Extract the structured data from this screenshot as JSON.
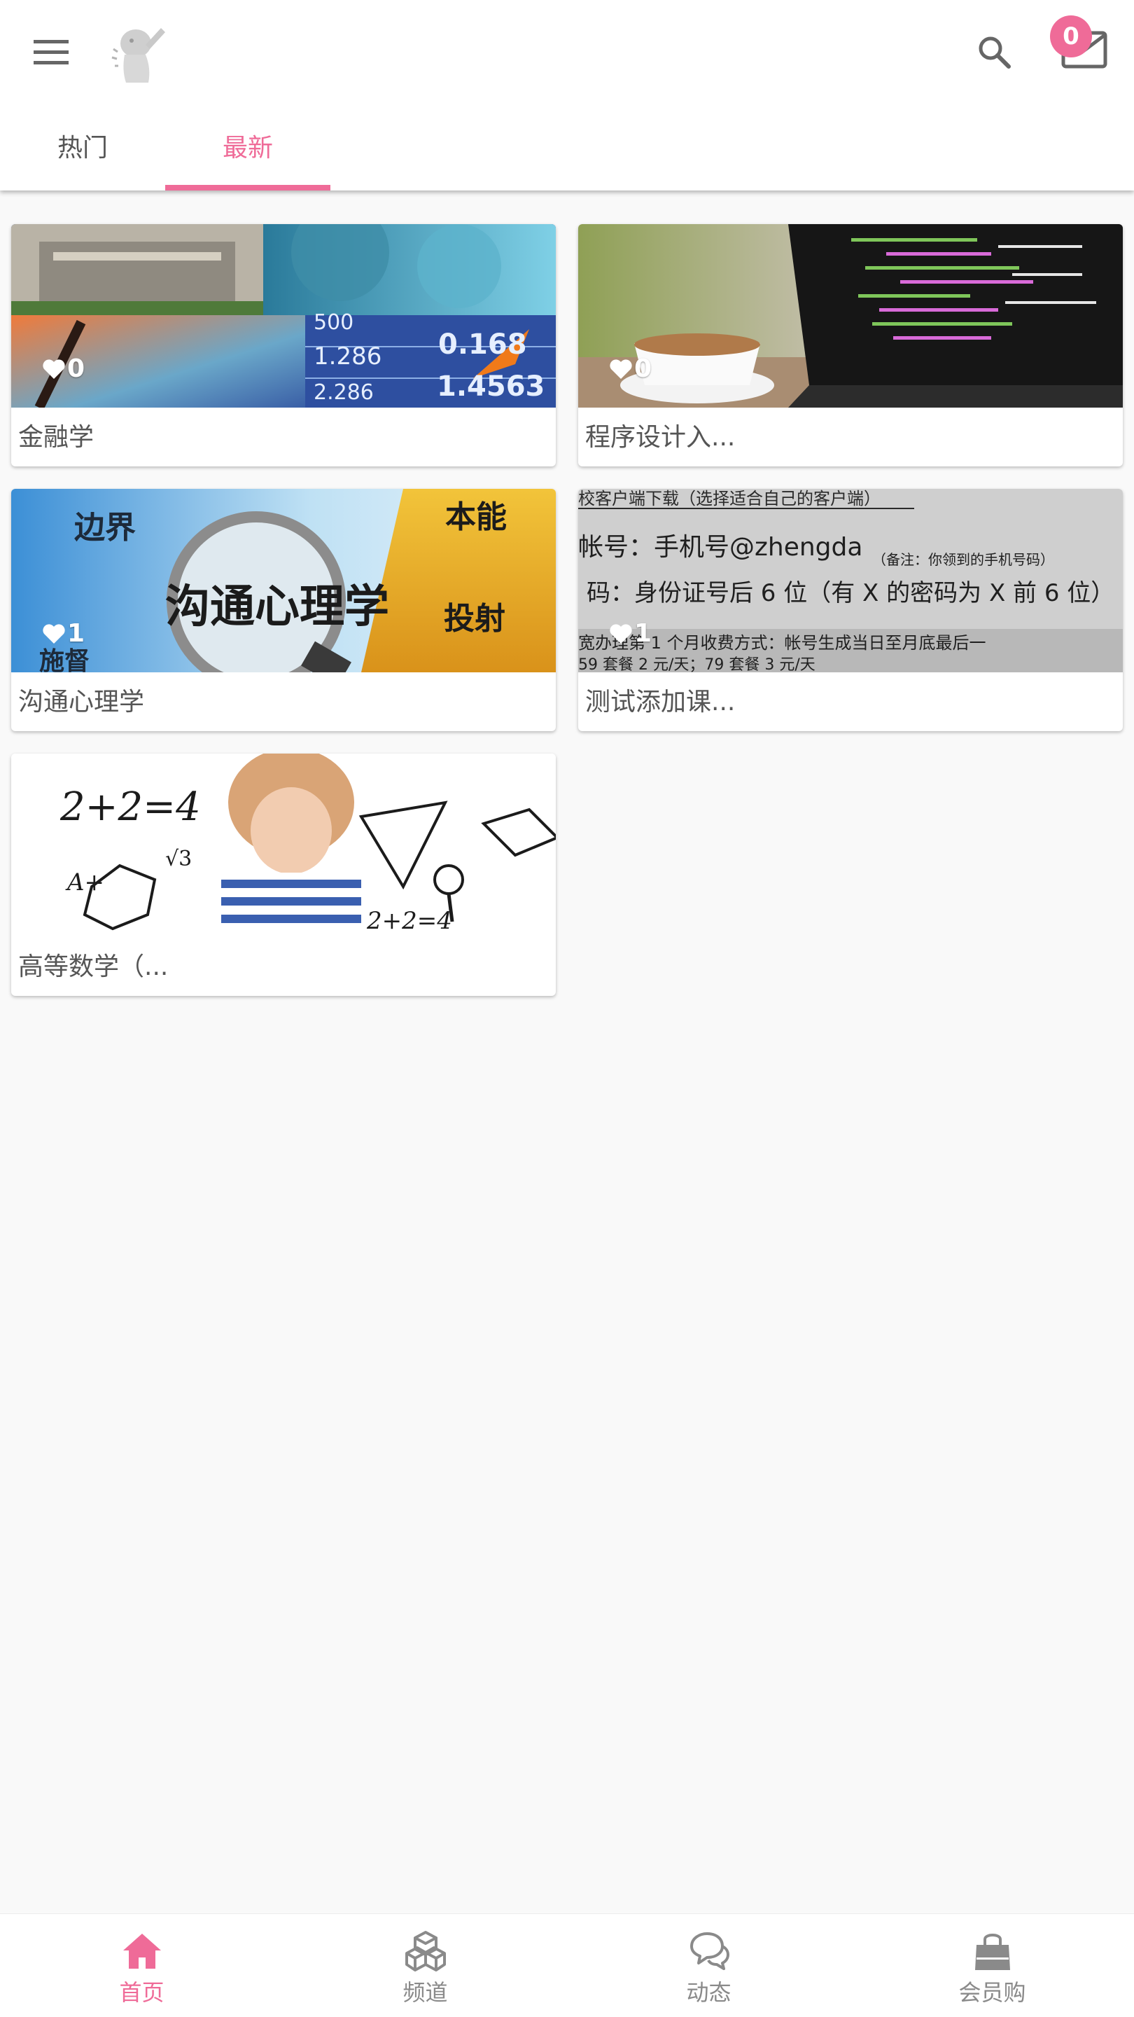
{
  "colors": {
    "accent": "#ef6b98",
    "text": "#555555",
    "icon_gray": "#8a8a8a",
    "background": "#f9f9f9"
  },
  "header": {
    "menu_icon": "hamburger-menu-icon",
    "logo_icon": "app-logo-figure",
    "search_icon": "search-icon",
    "mail_icon": "mail-icon",
    "mail_badge": "0"
  },
  "tabs": [
    {
      "label": "热门",
      "active": false
    },
    {
      "label": "最新",
      "active": true
    }
  ],
  "courses": [
    {
      "title": "金融学",
      "likes": "0",
      "image": "finance-stock-chart"
    },
    {
      "title": "程序设计入...",
      "likes": "0",
      "image": "laptop-code-coffee"
    },
    {
      "title": "沟通心理学",
      "likes": "1",
      "image": "magnifier-communication"
    },
    {
      "title": "测试添加课...",
      "likes": "1",
      "image": "printed-document-photo"
    },
    {
      "title": "高等数学（...",
      "likes": "",
      "image": "girl-math-sketches"
    }
  ],
  "image_text": {
    "finance": [
      "500",
      "1.286",
      "2.286",
      "0.168",
      "1.4563"
    ],
    "psychology": [
      "边界",
      "沟通心理学",
      "本能",
      "投射",
      "施督"
    ],
    "document": [
      "校客户端下载（选择适合自己的客户端）",
      "帐号：手机号@zhengda",
      "（备注：你领到的手机号码）",
      "码：身份证号后 6 位（有 X 的密码为 X 前 6 位）",
      "宽办理第 1 个月收费方式：帐号生成当日至月底最后一",
      "59 套餐 2 元/天；79 套餐 3 元/天"
    ],
    "math": [
      "2+2=4",
      "A+",
      "√3",
      "2+2=4"
    ]
  },
  "bottom_nav": [
    {
      "label": "首页",
      "icon": "home-icon",
      "active": true
    },
    {
      "label": "频道",
      "icon": "cubes-icon",
      "active": false
    },
    {
      "label": "动态",
      "icon": "chat-bubbles-icon",
      "active": false
    },
    {
      "label": "会员购",
      "icon": "shopping-bag-icon",
      "active": false
    }
  ]
}
